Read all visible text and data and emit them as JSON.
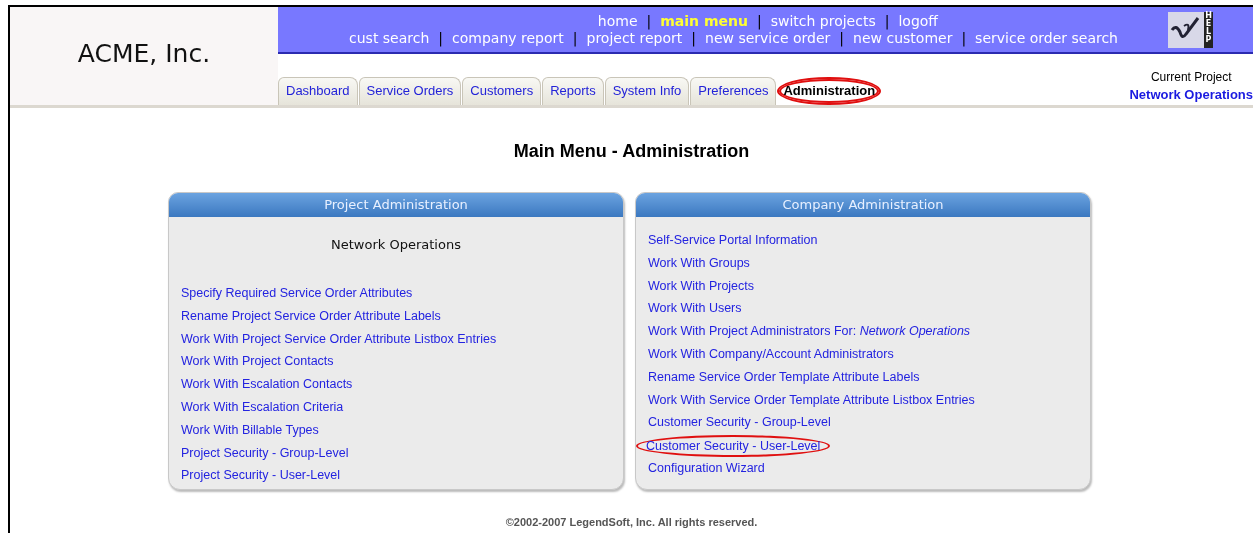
{
  "company": {
    "name": "ACME, Inc."
  },
  "nav": {
    "separator": "|",
    "top_links": [
      {
        "label": "home",
        "selected": false
      },
      {
        "label": "main menu",
        "selected": true
      },
      {
        "label": "switch projects",
        "selected": false
      },
      {
        "label": "logoff",
        "selected": false
      }
    ],
    "bottom_links": [
      {
        "label": "cust search",
        "selected": false
      },
      {
        "label": "company report",
        "selected": false
      },
      {
        "label": "project report",
        "selected": false
      },
      {
        "label": "new service order",
        "selected": false
      },
      {
        "label": "new customer",
        "selected": false
      },
      {
        "label": "service order search",
        "selected": false
      }
    ],
    "help_label": "HELP"
  },
  "tabs": [
    {
      "label": "Dashboard",
      "selected": false,
      "circled": false
    },
    {
      "label": "Service Orders",
      "selected": false,
      "circled": false
    },
    {
      "label": "Customers",
      "selected": false,
      "circled": false
    },
    {
      "label": "Reports",
      "selected": false,
      "circled": false
    },
    {
      "label": "System Info",
      "selected": false,
      "circled": false
    },
    {
      "label": "Preferences",
      "selected": false,
      "circled": false
    },
    {
      "label": "Administration",
      "selected": true,
      "circled": true
    }
  ],
  "current_project": {
    "label": "Current Project",
    "value": "Network Operations"
  },
  "page_title": "Main Menu - Administration",
  "panels": [
    {
      "title": "Project Administration",
      "subtitle": "Network Operations",
      "links": [
        {
          "text": "Specify Required Service Order Attributes",
          "circled": false
        },
        {
          "text": "Rename Project Service Order Attribute Labels",
          "circled": false
        },
        {
          "text": "Work With Project Service Order Attribute Listbox Entries",
          "circled": false
        },
        {
          "text": "Work With Project Contacts",
          "circled": false
        },
        {
          "text": "Work With Escalation Contacts",
          "circled": false
        },
        {
          "text": "Work With Escalation Criteria",
          "circled": false
        },
        {
          "text": "Work With Billable Types",
          "circled": false
        },
        {
          "text": "Project Security - Group-Level",
          "circled": false
        },
        {
          "text": "Project Security - User-Level",
          "circled": false
        }
      ]
    },
    {
      "title": "Company Administration",
      "links": [
        {
          "text": "Self-Service Portal Information",
          "circled": false
        },
        {
          "text": "Work With Groups",
          "circled": false
        },
        {
          "text": "Work With Projects",
          "circled": false
        },
        {
          "text": "Work With Users",
          "circled": false
        },
        {
          "text": "Work With Project Administrators For:  *Network Operations*",
          "circled": false
        },
        {
          "text": "Work With Company/Account Administrators",
          "circled": false
        },
        {
          "text": "Rename Service Order Template Attribute Labels",
          "circled": false
        },
        {
          "text": "Work With Service Order Template Attribute Listbox Entries",
          "circled": false
        },
        {
          "text": "Customer Security - Group-Level",
          "circled": false
        },
        {
          "text": "Customer Security - User-Level",
          "circled": true
        },
        {
          "text": "Configuration Wizard",
          "circled": false
        }
      ]
    }
  ],
  "footer": "©2002-2007 LegendSoft, Inc. All rights reserved."
}
